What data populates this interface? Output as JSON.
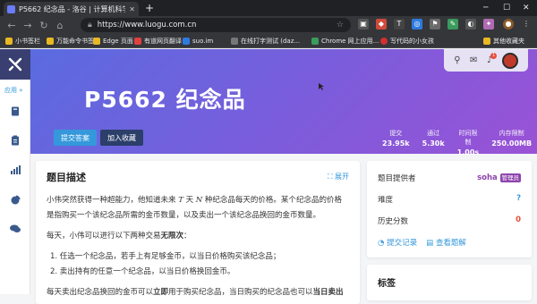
{
  "browser": {
    "tab_title": "P5662 纪念品 - 洛谷 | 计算机科学教...",
    "url": "https://www.luogu.com.cn",
    "bookmarks": [
      "小书签栏",
      "万能命令书签",
      "Edge 页面",
      "有道网页翻译",
      "suo.im",
      "在线打字测试 (daz...",
      "Chrome 网上应用...",
      "写代码的小女孩",
      "其他收藏夹"
    ]
  },
  "sidebar": {
    "menu_label": "应用 »",
    "icons": [
      "book-icon",
      "clipboard-icon",
      "bar-chart-icon",
      "pie-chart-icon",
      "chat-icon"
    ]
  },
  "header": {
    "notification_count": "1",
    "title": "P5662 纪念品",
    "submit_button": "提交答案",
    "favorite_button": "加入收藏",
    "stats": [
      {
        "label": "提交",
        "value": "23.95k"
      },
      {
        "label": "通过",
        "value": "5.30k"
      },
      {
        "label": "时间限制",
        "value": "1.00s"
      },
      {
        "label": "内存限制",
        "value": "250.00MB"
      }
    ]
  },
  "description": {
    "heading": "题目描述",
    "expand": "展开",
    "p1_a": "小伟突然获得一种超能力，他知道未来 ",
    "var_t": "T",
    "p1_b": " 天 ",
    "var_n": "N",
    "p1_c": " 种纪念品每天的价格。某个纪念品的价格",
    "p2": "是指购买一个该纪念品所需的金币数量，以及卖出一个该纪念品换回的金币数量。",
    "p3_a": "每天，小伟可以进行以下两种交易",
    "p3_b": "无限次",
    "p3_c": "：",
    "li1": "1. 任选一个纪念品，若手上有足够金币，以当日价格购买该纪念品；",
    "li2": "2. 卖出持有的任意一个纪念品，以当日价格换回金币。",
    "p4_a": "每天卖出纪念品换回的金币可以",
    "p4_b": "立即",
    "p4_c": "用于购买纪念品，当日购买的纪念品也可以",
    "p4_d": "当日卖出"
  },
  "info": {
    "provider_label": "题目提供者",
    "provider_name": "soha",
    "provider_badge": "管理员",
    "difficulty_label": "难度",
    "difficulty_value": "?",
    "score_label": "历史分数",
    "score_value": "0",
    "submissions_link": "提交记录",
    "solutions_link": "查看题解"
  },
  "tags": {
    "heading": "标签"
  },
  "colors": {
    "accent": "#3498db",
    "brand_dark": "#3a3f72",
    "red": "#e74c3c",
    "purple": "#8e44ad"
  }
}
